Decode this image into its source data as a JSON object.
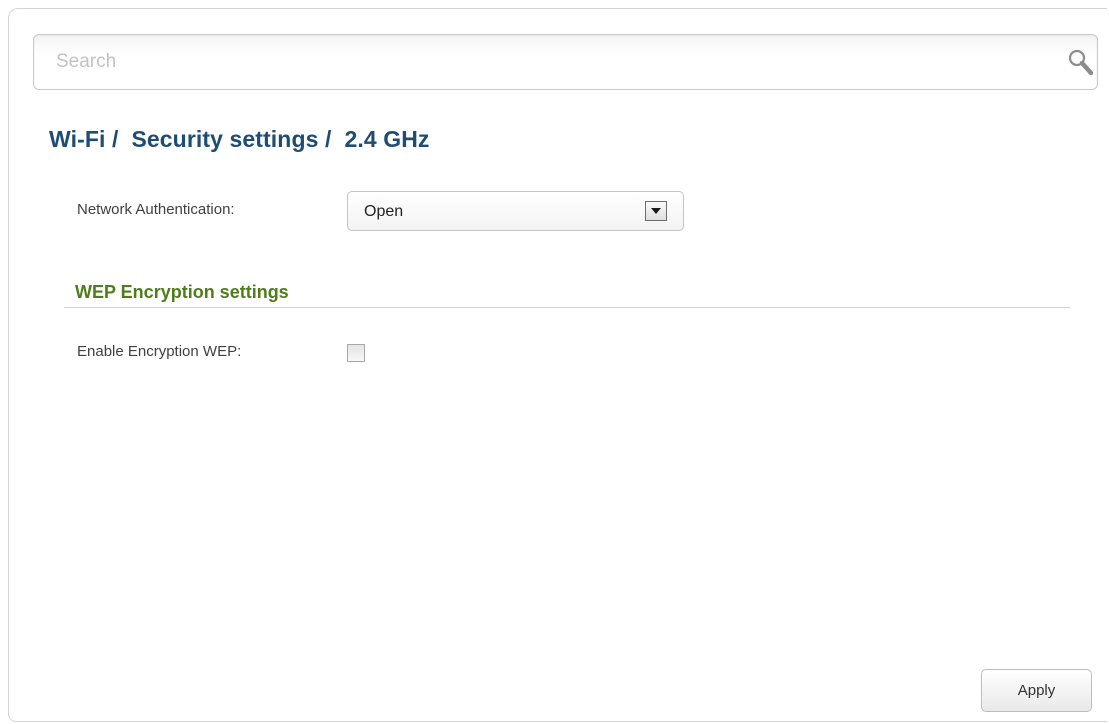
{
  "search": {
    "placeholder": "Search",
    "value": "",
    "icon": "search-icon"
  },
  "breadcrumb": {
    "text": "Wi-Fi /  Security settings /  2.4 GHz"
  },
  "form": {
    "network_auth": {
      "label": "Network Authentication:",
      "value": "Open"
    },
    "wep_section": {
      "title": "WEP Encryption settings"
    },
    "enable_wep": {
      "label": "Enable Encryption WEP:",
      "checked": false
    }
  },
  "actions": {
    "apply_label": "Apply"
  },
  "colors": {
    "title": "#1f4c72",
    "section_title": "#4f7d1c"
  }
}
